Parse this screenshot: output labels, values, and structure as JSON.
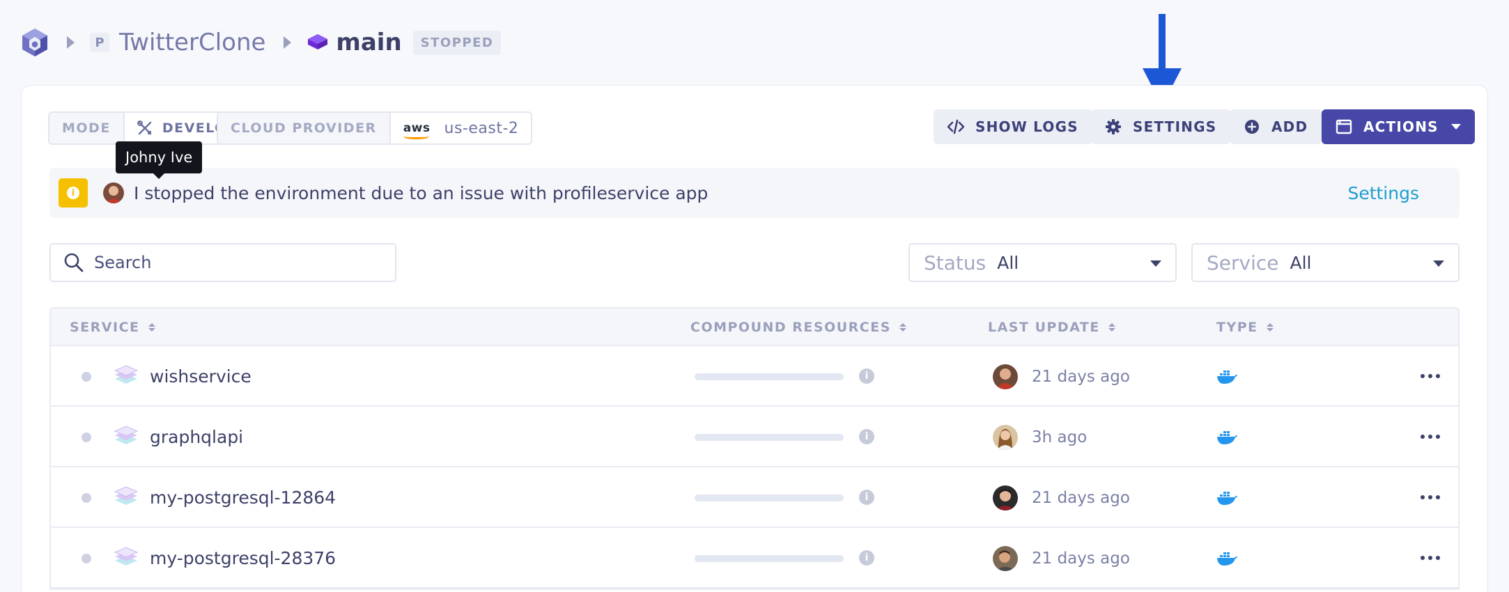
{
  "breadcrumb": {
    "project_initial": "P",
    "project_name": "TwitterClone",
    "environment_name": "main",
    "status": "STOPPED"
  },
  "toolbar": {
    "mode_label": "MODE",
    "mode_value": "DEVELOPMENT",
    "cloud_label": "CLOUD PROVIDER",
    "cloud_logo": "aws",
    "cloud_region": "us-east-2",
    "show_logs_label": "SHOW LOGS",
    "settings_label": "SETTINGS",
    "add_label": "ADD",
    "actions_label": "ACTIONS"
  },
  "tooltip": {
    "text": "Johny Ive"
  },
  "notice": {
    "message": "I stopped the environment due to an issue with profileservice app",
    "link_label": "Settings"
  },
  "filters": {
    "search_placeholder": "Search",
    "status_label": "Status",
    "status_value": "All",
    "service_label": "Service",
    "service_value": "All"
  },
  "table": {
    "columns": [
      "SERVICE",
      "COMPOUND RESOURCES",
      "LAST UPDATE",
      "TYPE"
    ],
    "rows": [
      {
        "name": "wishservice",
        "last_update": "21 days ago",
        "type_icon": "docker-icon"
      },
      {
        "name": "graphqlapi",
        "last_update": "3h ago",
        "type_icon": "docker-icon"
      },
      {
        "name": "my-postgresql-12864",
        "last_update": "21 days ago",
        "type_icon": "docker-icon"
      },
      {
        "name": "my-postgresql-28376",
        "last_update": "21 days ago",
        "type_icon": "docker-icon"
      }
    ]
  },
  "colors": {
    "primary": "#4747a8",
    "arrow": "#1c57d6",
    "link": "#1e9ecf",
    "warning": "#f5c000",
    "docker": "#2496ed"
  }
}
